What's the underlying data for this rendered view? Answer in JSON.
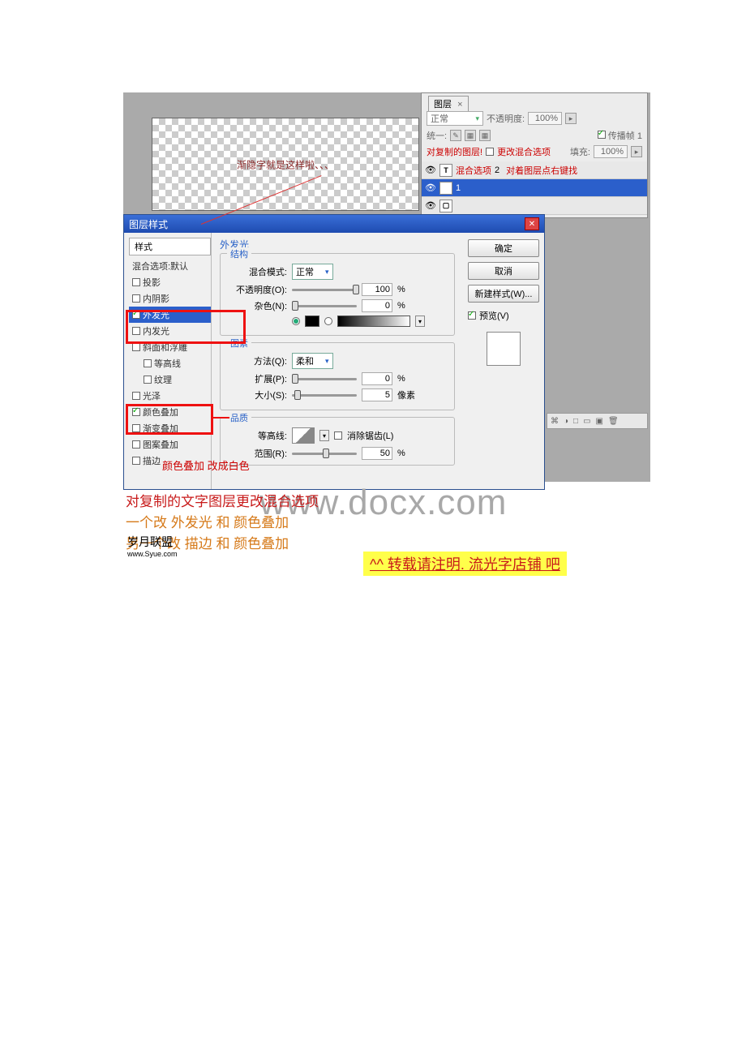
{
  "layers_panel": {
    "tab": "图层",
    "blend_mode": "正常",
    "opacity_label": "不透明度:",
    "opacity_value": "100%",
    "lock_label": "统一:",
    "propagate_label": "传播帧 1",
    "fill_label": "填充:",
    "fill_value": "100%",
    "annot1": "对复制的图层!",
    "annot2": "更改混合选项",
    "annot3": "混合选项",
    "annot4": "对着图层点右键找",
    "layer_copy_name": "2",
    "layer_name": "1"
  },
  "dialog": {
    "title": "图层样式",
    "styles": {
      "head": "样式",
      "blend_default": "混合选项:默认",
      "drop_shadow": "投影",
      "inner_shadow": "内阴影",
      "outer_glow": "外发光",
      "inner_glow": "内发光",
      "bevel": "斜面和浮雕",
      "contour": "等高线",
      "texture": "纹理",
      "satin": "光泽",
      "color_overlay": "颜色叠加",
      "gradient_overlay": "渐变叠加",
      "pattern_overlay": "图案叠加",
      "stroke": "描边"
    },
    "main": {
      "section": "外发光",
      "group_structure": "结构",
      "blend_mode_label": "混合模式:",
      "blend_mode_value": "正常",
      "opacity_label": "不透明度(O):",
      "opacity_value": "100",
      "noise_label": "杂色(N):",
      "noise_value": "0",
      "group_element": "图素",
      "method_label": "方法(Q):",
      "method_value": "柔和",
      "spread_label": "扩展(P):",
      "spread_value": "0",
      "size_label": "大小(S):",
      "size_value": "5",
      "size_unit": "像素",
      "group_quality": "品质",
      "contour_label": "等高线:",
      "antialias_label": "消除锯齿(L)",
      "range_label": "范围(R):",
      "range_value": "50",
      "percent": "%"
    },
    "buttons": {
      "ok": "确定",
      "cancel": "取消",
      "new_style": "新建样式(W)...",
      "preview": "预览(V)"
    }
  },
  "canvas_text": "渐隐字就是这样啦、、、",
  "bottom_annot": {
    "line1": "对复制的文字图层更改混合选项",
    "line2a": "一个改  外发光  和  颜色叠加",
    "line2b": "另一个改  描边  和  颜色叠加",
    "overlay_red": "颜色叠加   改成白色"
  },
  "watermark": "www.docx.com",
  "logo_text": "岁月联盟",
  "logo_url": "www.Syue.com",
  "repost": "^^ 转载请注明. 流光字店铺   吧"
}
